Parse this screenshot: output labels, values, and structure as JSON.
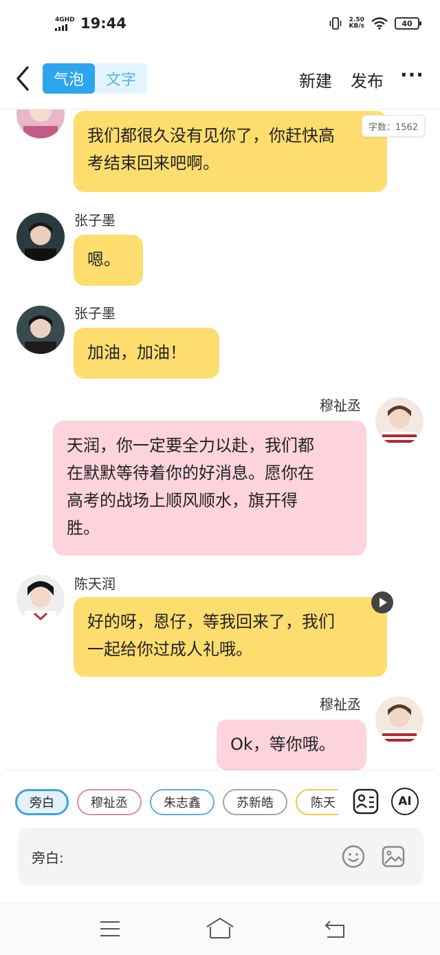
{
  "status_bar": {
    "network": "4GHD",
    "time": "19:44",
    "speed_value": "2.50",
    "speed_unit": "KB/s",
    "battery": "40"
  },
  "header": {
    "tab_bubble": "气泡",
    "tab_text": "文字",
    "new_label": "新建",
    "publish_label": "发布",
    "more_label": "···"
  },
  "word_count": "字数：1562",
  "messages": [
    {
      "side": "left",
      "speaker": "",
      "text_lines": [
        "我们都很久没有见你了，你赶快高",
        "考结束回来吧啊。"
      ],
      "color": "#fedd6f"
    },
    {
      "side": "left",
      "speaker": "张子墨",
      "text_lines": [
        "嗯。"
      ],
      "color": "#fedd6f"
    },
    {
      "side": "left",
      "speaker": "张子墨",
      "text_lines": [
        "加油，加油！"
      ],
      "color": "#fedd6f"
    },
    {
      "side": "right",
      "speaker": "穆祉丞",
      "text_lines": [
        "天润，你一定要全力以赴，我们都",
        "在默默等待着你的好消息。愿你在",
        "高考的战场上顺风顺水，旗开得",
        "胜。"
      ],
      "color": "#fdd3dd"
    },
    {
      "side": "left",
      "speaker": "陈天润",
      "text_lines": [
        "好的呀，恩仔，等我回来了，我们",
        "一起给你过成人礼哦。"
      ],
      "color": "#fedd6f"
    },
    {
      "side": "right",
      "speaker": "穆祉丞",
      "text_lines": [
        "Ok，等你哦。"
      ],
      "color": "#fdd3dd"
    }
  ],
  "characters": [
    "旁白",
    "穆祉丞",
    "朱志鑫",
    "苏新皓",
    "陈天"
  ],
  "ai_label": "AI",
  "input": {
    "label": "旁白:"
  },
  "icons": {
    "back": "chevron-left-icon",
    "role": "id-card-icon",
    "emoji": "smile-icon",
    "image": "image-icon",
    "play": "play-icon"
  }
}
